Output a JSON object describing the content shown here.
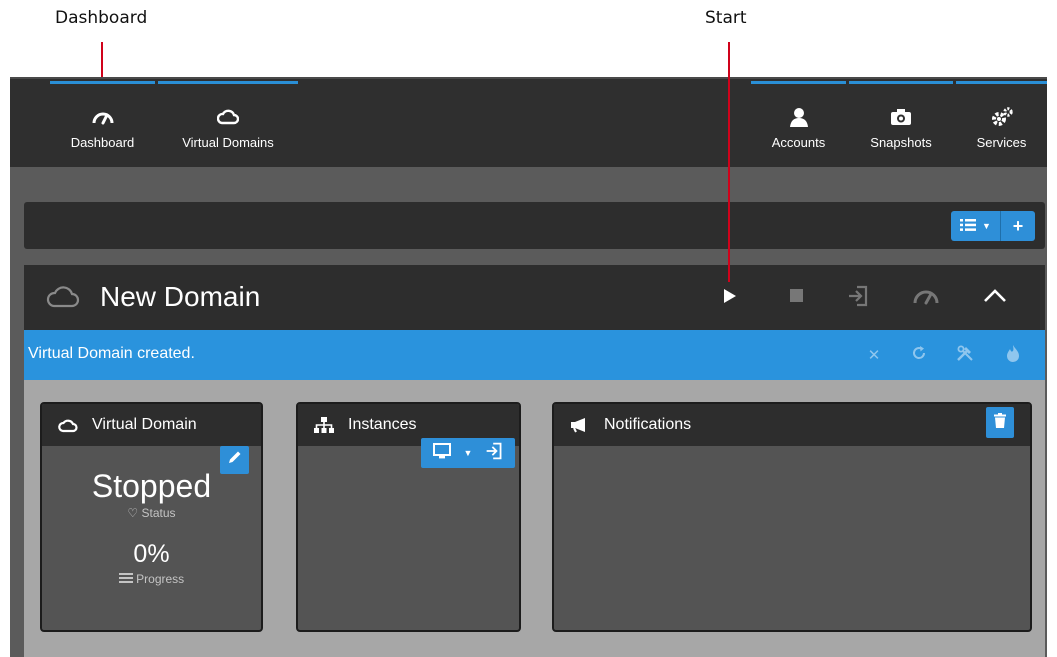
{
  "callouts": {
    "dashboard": "Dashboard",
    "start": "Start"
  },
  "nav": {
    "left": [
      {
        "label": "Dashboard",
        "icon": "dashboard-gauge-icon"
      },
      {
        "label": "Virtual Domains",
        "icon": "cloud-icon"
      }
    ],
    "right": [
      {
        "label": "Accounts",
        "icon": "user-icon"
      },
      {
        "label": "Snapshots",
        "icon": "camera-icon"
      },
      {
        "label": "Services",
        "icon": "gears-icon"
      }
    ]
  },
  "toolbar": {
    "list_icon": "list-icon",
    "add_icon": "plus-icon"
  },
  "domain": {
    "title": "New Domain",
    "actions": [
      "play-icon",
      "stop-icon",
      "sign-in-icon",
      "gauge-icon",
      "chevron-up-icon"
    ]
  },
  "alert": {
    "message": "Virtual Domain created.",
    "actions": [
      "close-icon",
      "refresh-icon",
      "tools-icon",
      "fire-icon"
    ]
  },
  "cards": {
    "virtual_domain": {
      "title": "Virtual Domain",
      "status_value": "Stopped",
      "status_label": "Status",
      "progress_value": "0%",
      "progress_label": "Progress"
    },
    "instances": {
      "title": "Instances"
    },
    "notifications": {
      "title": "Notifications"
    }
  },
  "colors": {
    "accent": "#2e8fd8",
    "alert": "#2a93dd",
    "callout_line": "#d0021b",
    "dark_panel": "#2d2d2d"
  }
}
